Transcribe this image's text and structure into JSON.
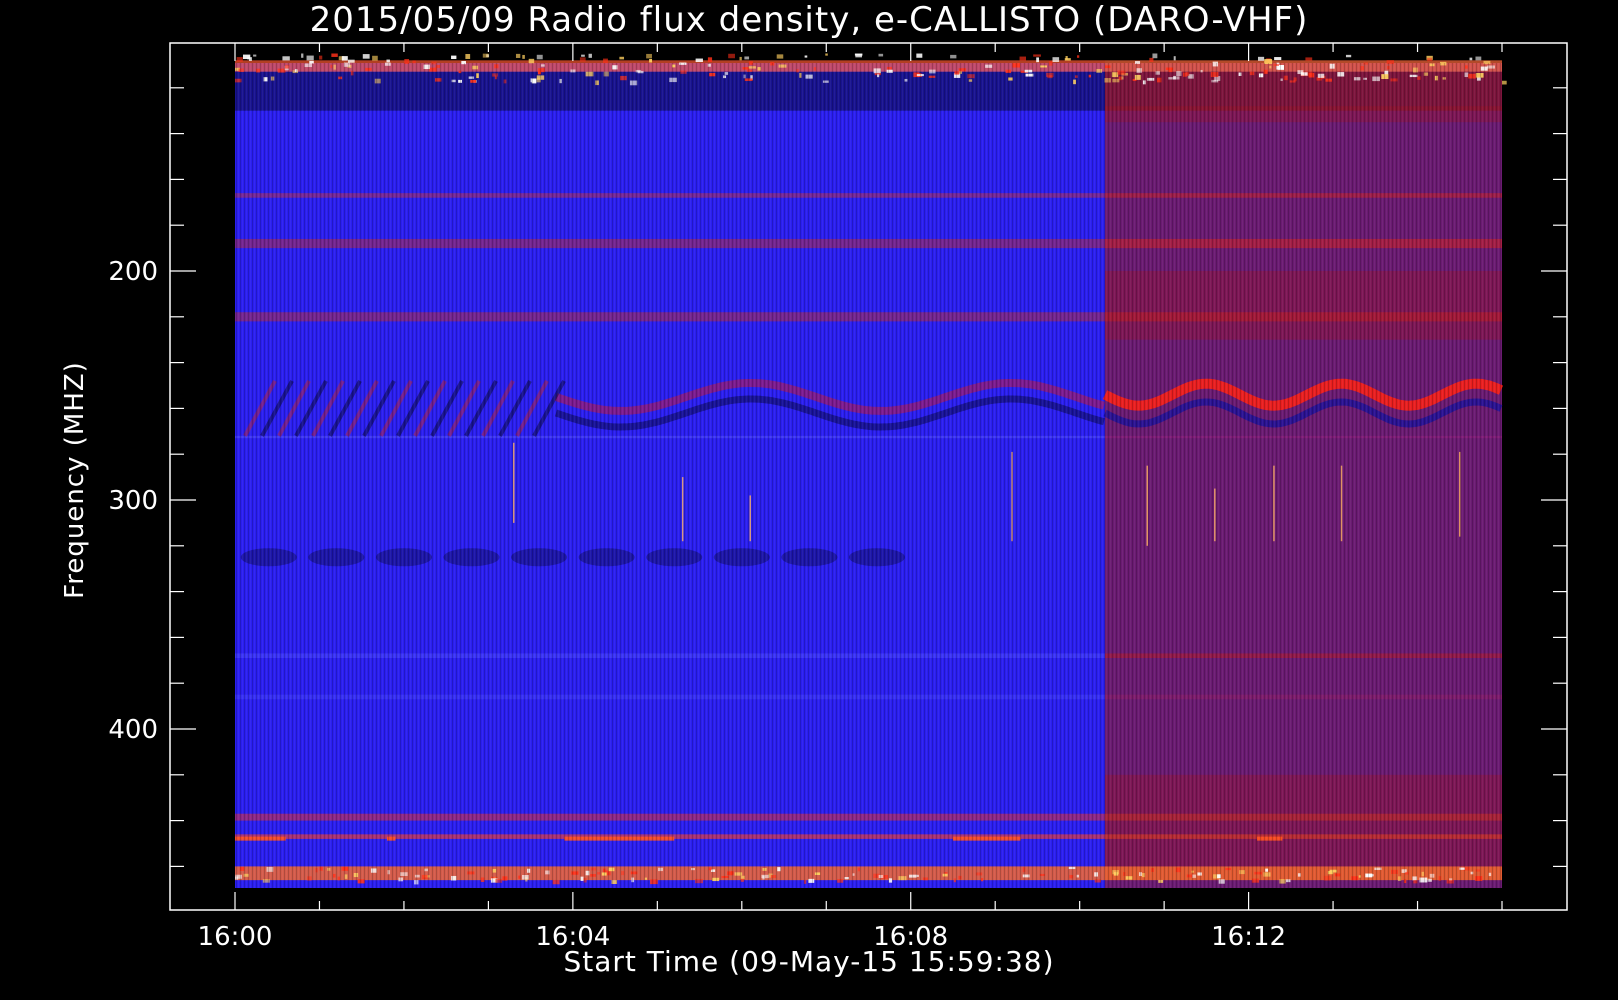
{
  "chart_data": {
    "type": "heatmap",
    "title": "2015/05/09  Radio flux density, e-CALLISTO (DARO-VHF)",
    "xlabel": "Start Time (09-May-15 15:59:38)",
    "ylabel": "Frequency (MHZ)",
    "x_tick_labels": [
      "16:00",
      "16:04",
      "16:08",
      "16:12"
    ],
    "x_ticks_minutes": [
      0,
      4,
      8,
      12
    ],
    "x_range_minutes": [
      0,
      15
    ],
    "y_tick_labels": [
      "200",
      "300",
      "400"
    ],
    "y_ticks": [
      200,
      300,
      400
    ],
    "y_range_mhz": [
      100,
      470
    ],
    "y_axis_inverted": true,
    "segments": [
      {
        "name": "blue segment",
        "start_min": 0,
        "end_min": 10.3,
        "color": "#2a1ef0"
      },
      {
        "name": "red segment",
        "start_min": 10.3,
        "end_min": 15,
        "color": "#6a1a72"
      }
    ],
    "colors": {
      "background": "#000000",
      "axis": "#ffffff",
      "low": "#1a0ad0",
      "mid": "#3a30ff",
      "high": "#ff3018",
      "peak": "#ffd060"
    }
  }
}
